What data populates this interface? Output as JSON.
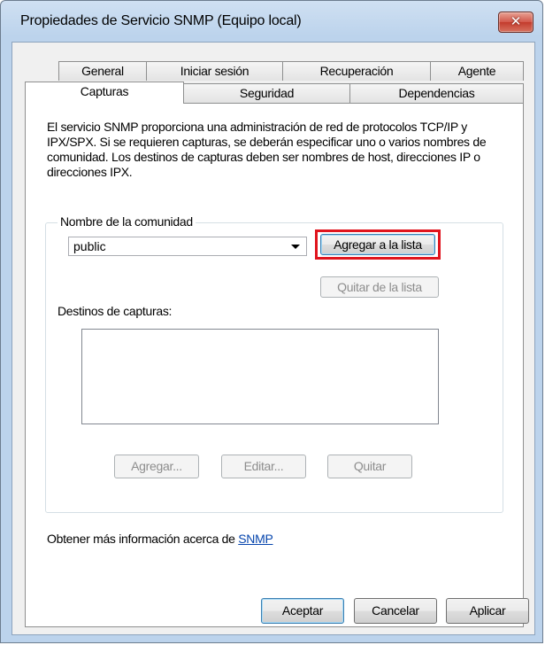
{
  "window": {
    "title": "Propiedades de Servicio SNMP (Equipo local)",
    "close_glyph": "✕"
  },
  "tabs": {
    "row1": [
      "General",
      "Iniciar sesión",
      "Recuperación",
      "Agente"
    ],
    "row2": [
      "Capturas",
      "Seguridad",
      "Dependencias"
    ],
    "active": "Capturas"
  },
  "panel": {
    "description": "El servicio SNMP proporciona una administración de red de protocolos TCP/IP y IPX/SPX. Si se requieren capturas, se deberán especificar uno o varios nombres de comunidad. Los destinos de capturas deben ser nombres de host, direcciones IP o direcciones IPX.",
    "community_group_label": "Nombre de la comunidad",
    "community_value": "public",
    "add_to_list": "Agregar a la lista",
    "remove_from_list": "Quitar de la lista",
    "destinations_label": "Destinos de capturas:",
    "add": "Agregar...",
    "edit": "Editar...",
    "remove": "Quitar",
    "more_info_text": "Obtener más información acerca de ",
    "more_info_link": "SNMP"
  },
  "footer": {
    "ok": "Aceptar",
    "cancel": "Cancelar",
    "apply": "Aplicar"
  },
  "colors": {
    "highlight": "#e0141d",
    "link": "#0645ad",
    "close_button": "#c33c2d"
  }
}
